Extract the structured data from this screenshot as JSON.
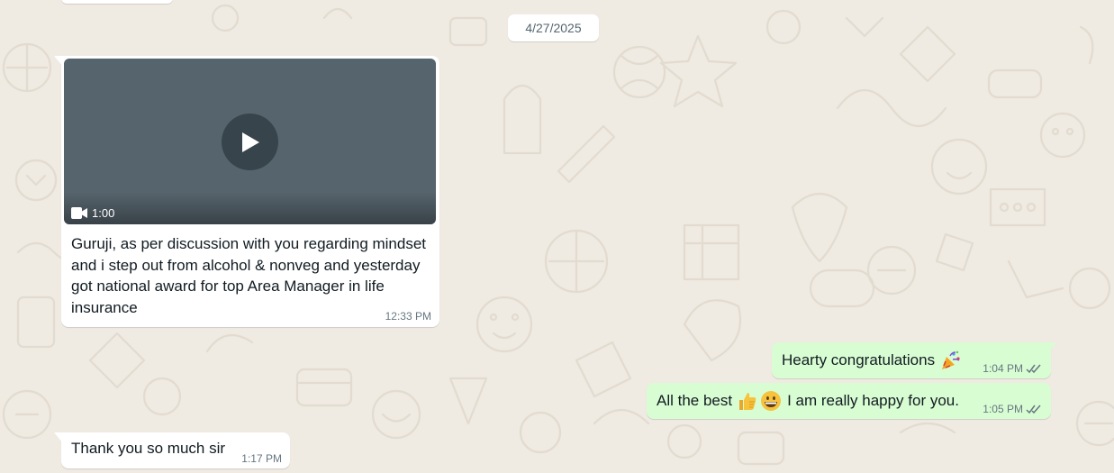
{
  "conversation": {
    "date_separator": "4/27/2025",
    "messages": [
      {
        "direction": "incoming",
        "type": "video",
        "video_duration": "1:00",
        "icons": {
          "play": "play-icon",
          "video": "video-camera-icon"
        },
        "caption": "Guruji, as per discussion with you regarding mindset and i step out from alcohol & nonveg and yesterday got national award for top Area Manager in life insurance",
        "time": "12:33 PM"
      },
      {
        "direction": "outgoing",
        "text": "Hearty congratulations",
        "emoji": [
          "party-popper-icon"
        ],
        "time": "1:04 PM",
        "status_icon": "double-check-icon"
      },
      {
        "direction": "outgoing",
        "text_before": "All the best",
        "emoji": [
          "thumbs-up-icon",
          "grinning-face-icon"
        ],
        "text_after": "I am really happy for you.",
        "time": "1:05 PM",
        "status_icon": "double-check-icon"
      },
      {
        "direction": "incoming",
        "text": "Thank you so much sir",
        "time": "1:17 PM"
      }
    ]
  },
  "colors": {
    "wallpaper": "#efeae2",
    "incoming_bubble": "#ffffff",
    "outgoing_bubble": "#d9fdd3",
    "timestamp": "#667781",
    "video_thumbnail": "#56646d",
    "ticks": "#667781"
  }
}
